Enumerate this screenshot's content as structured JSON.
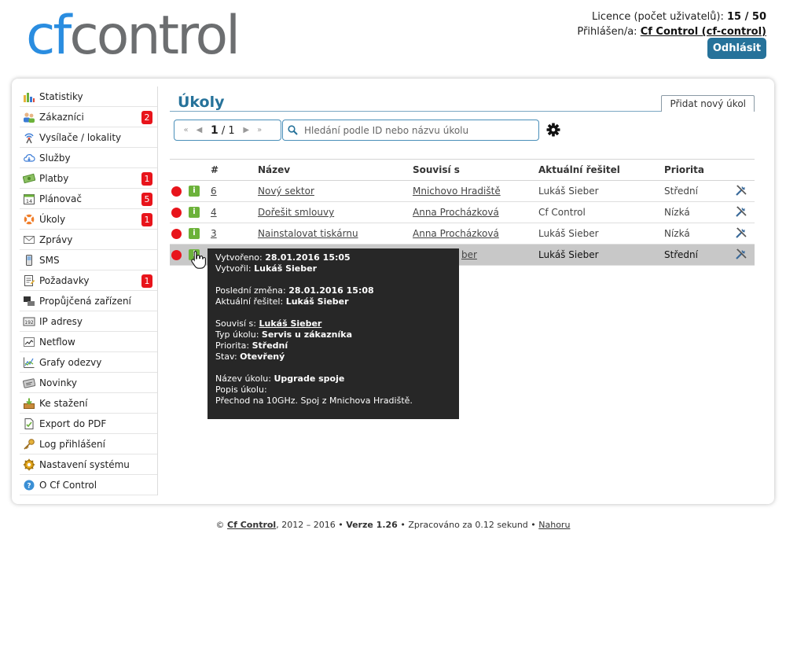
{
  "header": {
    "logo_cf": "cf",
    "logo_control": "control",
    "license_label": "Licence (počet uživatelů):",
    "license_value": "15 / 50",
    "logged_label": "Přihlášen/a:",
    "logged_user": "Cf Control (cf-control)",
    "logout": "Odhlásit"
  },
  "sidebar": {
    "items": [
      {
        "label": "Statistiky",
        "icon": "bar-chart-icon",
        "badge": ""
      },
      {
        "label": "Zákazníci",
        "icon": "users-icon",
        "badge": "2"
      },
      {
        "label": "Vysílače / lokality",
        "icon": "antenna-icon",
        "badge": ""
      },
      {
        "label": "Služby",
        "icon": "cloud-icon",
        "badge": ""
      },
      {
        "label": "Platby",
        "icon": "money-icon",
        "badge": "1"
      },
      {
        "label": "Plánovač",
        "icon": "calendar-icon",
        "badge": "5"
      },
      {
        "label": "Úkoly",
        "icon": "lifebuoy-icon",
        "badge": "1"
      },
      {
        "label": "Zprávy",
        "icon": "envelope-icon",
        "badge": ""
      },
      {
        "label": "SMS",
        "icon": "phone-icon",
        "badge": ""
      },
      {
        "label": "Požadavky",
        "icon": "request-icon",
        "badge": "1"
      },
      {
        "label": "Propůjčená zařízení",
        "icon": "device-icon",
        "badge": ""
      },
      {
        "label": "IP adresy",
        "icon": "ip-icon",
        "badge": ""
      },
      {
        "label": "Netflow",
        "icon": "netflow-icon",
        "badge": ""
      },
      {
        "label": "Grafy odezvy",
        "icon": "response-chart-icon",
        "badge": ""
      },
      {
        "label": "Novinky",
        "icon": "news-icon",
        "badge": ""
      },
      {
        "label": "Ke stažení",
        "icon": "download-icon",
        "badge": ""
      },
      {
        "label": "Export do PDF",
        "icon": "pdf-icon",
        "badge": ""
      },
      {
        "label": "Log přihlášení",
        "icon": "key-icon",
        "badge": ""
      },
      {
        "label": "Nastavení systému",
        "icon": "settings-icon",
        "badge": ""
      },
      {
        "label": "O Cf Control",
        "icon": "help-icon",
        "badge": ""
      }
    ]
  },
  "content": {
    "title": "Úkoly",
    "add_task": "Přidat nový úkol",
    "pager": {
      "current": "1",
      "separator": "/",
      "total": "1"
    },
    "search_placeholder": "Hledání podle ID nebo názvu úkolu",
    "table": {
      "headers": [
        "#",
        "Název",
        "Souvisí s",
        "Aktuální řešitel",
        "Priorita"
      ],
      "rows": [
        {
          "id": "6",
          "name": "Nový sektor",
          "related": "Mnichovo Hradiště",
          "assignee": "Lukáš Sieber",
          "priority": "Střední"
        },
        {
          "id": "4",
          "name": "Dořešit smlouvy",
          "related": "Anna Procházková",
          "assignee": "Cf Control",
          "priority": "Nízká"
        },
        {
          "id": "3",
          "name": "Nainstalovat tiskárnu",
          "related": "Anna Procházková",
          "assignee": "Lukáš Sieber",
          "priority": "Nízká"
        },
        {
          "id": "",
          "name": "",
          "related": "Lukáš Sieber",
          "related_visible": "ber",
          "assignee": "Lukáš Sieber",
          "priority": "Střední"
        }
      ]
    }
  },
  "tooltip": {
    "created_label": "Vytvořeno:",
    "created_value": "28.01.2016 15:05",
    "creator_label": "Vytvořil:",
    "creator_value": "Lukáš Sieber",
    "last_change_label": "Poslední změna:",
    "last_change_value": "28.01.2016 15:08",
    "assignee_label": "Aktuální řešitel:",
    "assignee_value": "Lukáš Sieber",
    "related_label": "Souvisí s:",
    "related_value": "Lukáš Sieber",
    "type_label": "Typ úkolu:",
    "type_value": "Servis u zákazníka",
    "priority_label": "Priorita:",
    "priority_value": "Střední",
    "state_label": "Stav:",
    "state_value": "Otevřený",
    "name_label": "Název úkolu:",
    "name_value": "Upgrade spoje",
    "desc_label": "Popis úkolu:",
    "desc_value": "Přechod na 10GHz. Spoj z Mnichova Hradiště."
  },
  "footer": {
    "copy": "©",
    "brand": "Cf Control",
    "years": ", 2012 – 2016 •",
    "version": "Verze 1.26",
    "processed": "• Zpracováno za 0.12 sekund •",
    "top": "Nahoru"
  },
  "colors": {
    "accent": "#26729a",
    "badge": "#e8141b",
    "info": "#6cb23a",
    "logo_blue": "#2a8de0"
  }
}
